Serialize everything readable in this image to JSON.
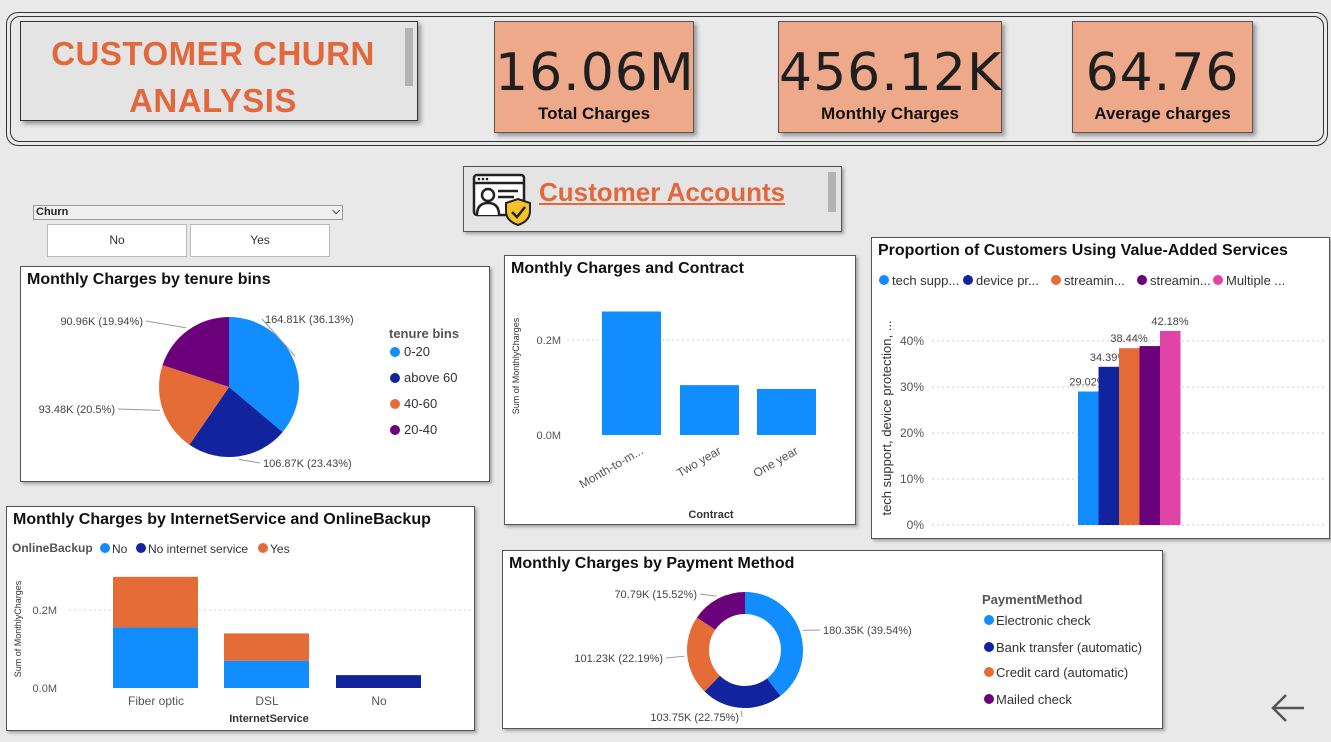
{
  "header": {
    "title_line1": "CUSTOMER CHURN",
    "title_line2": "ANALYSIS",
    "kpis": [
      {
        "value": "16.06M",
        "label": "Total Charges"
      },
      {
        "value": "456.12K",
        "label": "Monthly Charges"
      },
      {
        "value": "64.76",
        "label": "Average charges"
      }
    ]
  },
  "accounts_banner": {
    "label": "Customer Accounts",
    "icon": "account-security-icon"
  },
  "slicer": {
    "title": "Churn",
    "options": [
      "No",
      "Yes"
    ]
  },
  "colors": {
    "blue": "#118dff",
    "navy": "#12239e",
    "orange": "#e66c37",
    "purple": "#6b007b",
    "pink": "#e044a7",
    "accent": "#e2683b",
    "kpi_bg": "#eda98a"
  },
  "charts": {
    "tenure": {
      "title": "Monthly Charges by tenure bins",
      "legend_title": "tenure bins",
      "legend": [
        "0-20",
        "above 60",
        "40-60",
        "20-40"
      ],
      "labels": [
        "164.81K (36.13%)",
        "106.87K (23.43%)",
        "93.48K (20.5%)",
        "90.96K (19.94%)"
      ]
    },
    "contract": {
      "title": "Monthly Charges and Contract",
      "xlabel": "Contract",
      "ylabel": "Sum of MonthlyCharges",
      "yticks": [
        "0.2M",
        "0.0M"
      ],
      "categories": [
        "Month-to-m...",
        "Two year",
        "One year"
      ]
    },
    "services": {
      "title": "Proportion of Customers Using Value-Added Services",
      "legend": [
        "tech supp...",
        "device pr...",
        "streamin...",
        "streamin...",
        "Multiple ..."
      ],
      "ylabel": "tech support, device protection, ...",
      "yticks": [
        "40%",
        "30%",
        "20%",
        "10%",
        "0%"
      ],
      "labels": [
        "29.02%",
        "34.39%",
        "38.44%",
        "42.18%"
      ]
    },
    "internet": {
      "title": "Monthly Charges by InternetService and OnlineBackup",
      "legend_title": "OnlineBackup",
      "legend": [
        "No",
        "No internet service",
        "Yes"
      ],
      "ylabel": "Sum of MonthlyCharges",
      "xlabel": "InternetService",
      "yticks": [
        "0.2M",
        "0.0M"
      ],
      "categories": [
        "Fiber optic",
        "DSL",
        "No"
      ]
    },
    "payment": {
      "title": "Monthly Charges by Payment Method",
      "legend_title": "PaymentMethod",
      "legend": [
        "Electronic check",
        "Bank transfer (automatic)",
        "Credit card (automatic)",
        "Mailed check"
      ],
      "labels": [
        "180.35K (39.54%)",
        "103.75K (22.75%)",
        "101.23K (22.19%)",
        "70.79K (15.52%)"
      ]
    }
  },
  "chart_data": [
    {
      "type": "pie",
      "title": "Monthly Charges by tenure bins",
      "categories": [
        "0-20",
        "above 60",
        "40-60",
        "20-40"
      ],
      "values": [
        164.81,
        106.87,
        93.48,
        90.96
      ],
      "percents": [
        36.13,
        23.43,
        20.5,
        19.94
      ],
      "units": "K"
    },
    {
      "type": "bar",
      "title": "Monthly Charges and Contract",
      "categories": [
        "Month-to-m...",
        "Two year",
        "One year"
      ],
      "values": [
        0.26,
        0.105,
        0.097
      ],
      "xlabel": "Contract",
      "ylabel": "Sum of MonthlyCharges",
      "ylim": [
        0,
        0.28
      ],
      "units": "M"
    },
    {
      "type": "bar",
      "title": "Proportion of Customers Using Value-Added Services",
      "categories": [
        ""
      ],
      "series": [
        {
          "name": "tech supp...",
          "values": [
            29.02
          ]
        },
        {
          "name": "device pr...",
          "values": [
            34.39
          ]
        },
        {
          "name": "streamin...",
          "values": [
            38.44
          ]
        },
        {
          "name": "streamin...",
          "values": [
            38.9
          ]
        },
        {
          "name": "Multiple ...",
          "values": [
            42.18
          ]
        }
      ],
      "ylim": [
        0,
        45
      ],
      "ylabel": "tech support, device protection, ..."
    },
    {
      "type": "bar",
      "title": "Monthly Charges by InternetService and OnlineBackup",
      "categories": [
        "Fiber optic",
        "DSL",
        "No"
      ],
      "series": [
        {
          "name": "No",
          "values": [
            0.155,
            0.07,
            0
          ]
        },
        {
          "name": "No internet service",
          "values": [
            0,
            0,
            0.033
          ]
        },
        {
          "name": "Yes",
          "values": [
            0.13,
            0.07,
            0
          ]
        }
      ],
      "stacked": true,
      "xlabel": "InternetService",
      "ylabel": "Sum of MonthlyCharges",
      "units": "M"
    },
    {
      "type": "pie",
      "title": "Monthly Charges by Payment Method",
      "categories": [
        "Electronic check",
        "Bank transfer (automatic)",
        "Credit card (automatic)",
        "Mailed check"
      ],
      "values": [
        180.35,
        103.75,
        101.23,
        70.79
      ],
      "percents": [
        39.54,
        22.75,
        22.19,
        15.52
      ],
      "donut": true,
      "units": "K"
    }
  ]
}
